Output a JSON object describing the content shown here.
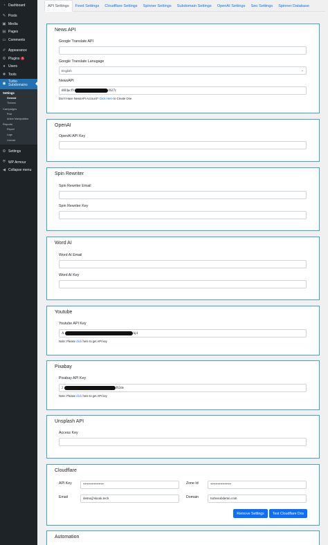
{
  "sidebar": {
    "items": [
      {
        "label": "Dashboard",
        "icon": "dashboard-icon"
      },
      {
        "label": "Posts",
        "icon": "pin-icon"
      },
      {
        "label": "Media",
        "icon": "media-icon"
      },
      {
        "label": "Pages",
        "icon": "page-icon"
      },
      {
        "label": "Comments",
        "icon": "comment-icon"
      },
      {
        "label": "Appearance",
        "icon": "brush-icon"
      },
      {
        "label": "Plugins",
        "icon": "plugin-icon",
        "badge": "1"
      },
      {
        "label": "Users",
        "icon": "user-icon"
      },
      {
        "label": "Tools",
        "icon": "wrench-icon"
      }
    ],
    "current": {
      "label_line1": "Turbo",
      "label_line2": "Subdomains"
    },
    "submenu": {
      "settings": "Settings",
      "general": "General",
      "themes": "Themes",
      "campaigns": "Campaigns",
      "post": "Post",
      "article_manipulation": "Article Manipulation",
      "reports": "Reports",
      "report": "Report",
      "logs": "Logs",
      "license": "License"
    },
    "settings": "Settings",
    "wp_armour": "WP Armour",
    "collapse": "Collapse menu"
  },
  "tabs": [
    {
      "label": "API Settings",
      "active": true
    },
    {
      "label": "Feed Settings"
    },
    {
      "label": "Cloudflare Settings"
    },
    {
      "label": "Spinner Settings"
    },
    {
      "label": "Subdomain Settings"
    },
    {
      "label": "OpenAI Settings"
    },
    {
      "label": "Seo Settings"
    },
    {
      "label": "Spinner Database"
    }
  ],
  "news_api": {
    "title": "News API",
    "google_translate_label": "Google Translate API",
    "google_translate_value": "",
    "language_label": "Google Translate Lanugage",
    "language_value": "English",
    "newsapi_label": "NewsAPI",
    "newsapi_prefix": "d6f4acf9",
    "newsapi_suffix": "f627c",
    "note_text": "Don't Have NewsAPI Account?",
    "note_link": "Click Here",
    "note_end": "to Create One"
  },
  "openai": {
    "title": "OpenAI",
    "key_label": "OpenAI API Key",
    "key_value": ""
  },
  "spin_rewriter": {
    "title": "Spin Rewriter",
    "email_label": "Spin Rewriter Email",
    "key_label": "Spin Rewriter Key"
  },
  "word_ai": {
    "title": "Word AI",
    "email_label": "Word AI Email",
    "key_label": "Word AI Key"
  },
  "youtube": {
    "title": "Youtube",
    "key_label": "Youtube API Key",
    "key_prefix": "A",
    "key_suffix": "hj4",
    "note_text": "Note: Please",
    "note_link": "click",
    "note_end": "here to get API key"
  },
  "pixabay": {
    "title": "Pixabay",
    "key_label": "Pixabay API Key",
    "key_prefix": "2",
    "key_suffix": "f62de",
    "note_text": "Note: Please",
    "note_link": "click",
    "note_end": "here to get API key"
  },
  "unsplash": {
    "title": "Unsplash API",
    "key_label": "Access Key"
  },
  "cloudflare": {
    "title": "Cloudflare",
    "api_key_label": "API Key",
    "api_key_value": "************",
    "zone_label": "Zone Id",
    "zone_value": "************",
    "email_label": "Email",
    "email_value": "demo@skunk.tech",
    "domain_label": "Domain",
    "domain_value": "turbosubdemo.com",
    "remove_button": "Remove Settings",
    "test_button": "Test Cloudflare Dns"
  },
  "automation": {
    "title": "Automation"
  },
  "colors": {
    "accent": "#2271b1",
    "button": "#0d6efd",
    "panel_border": "#3aa3dc",
    "sidebar": "#1d2327"
  }
}
